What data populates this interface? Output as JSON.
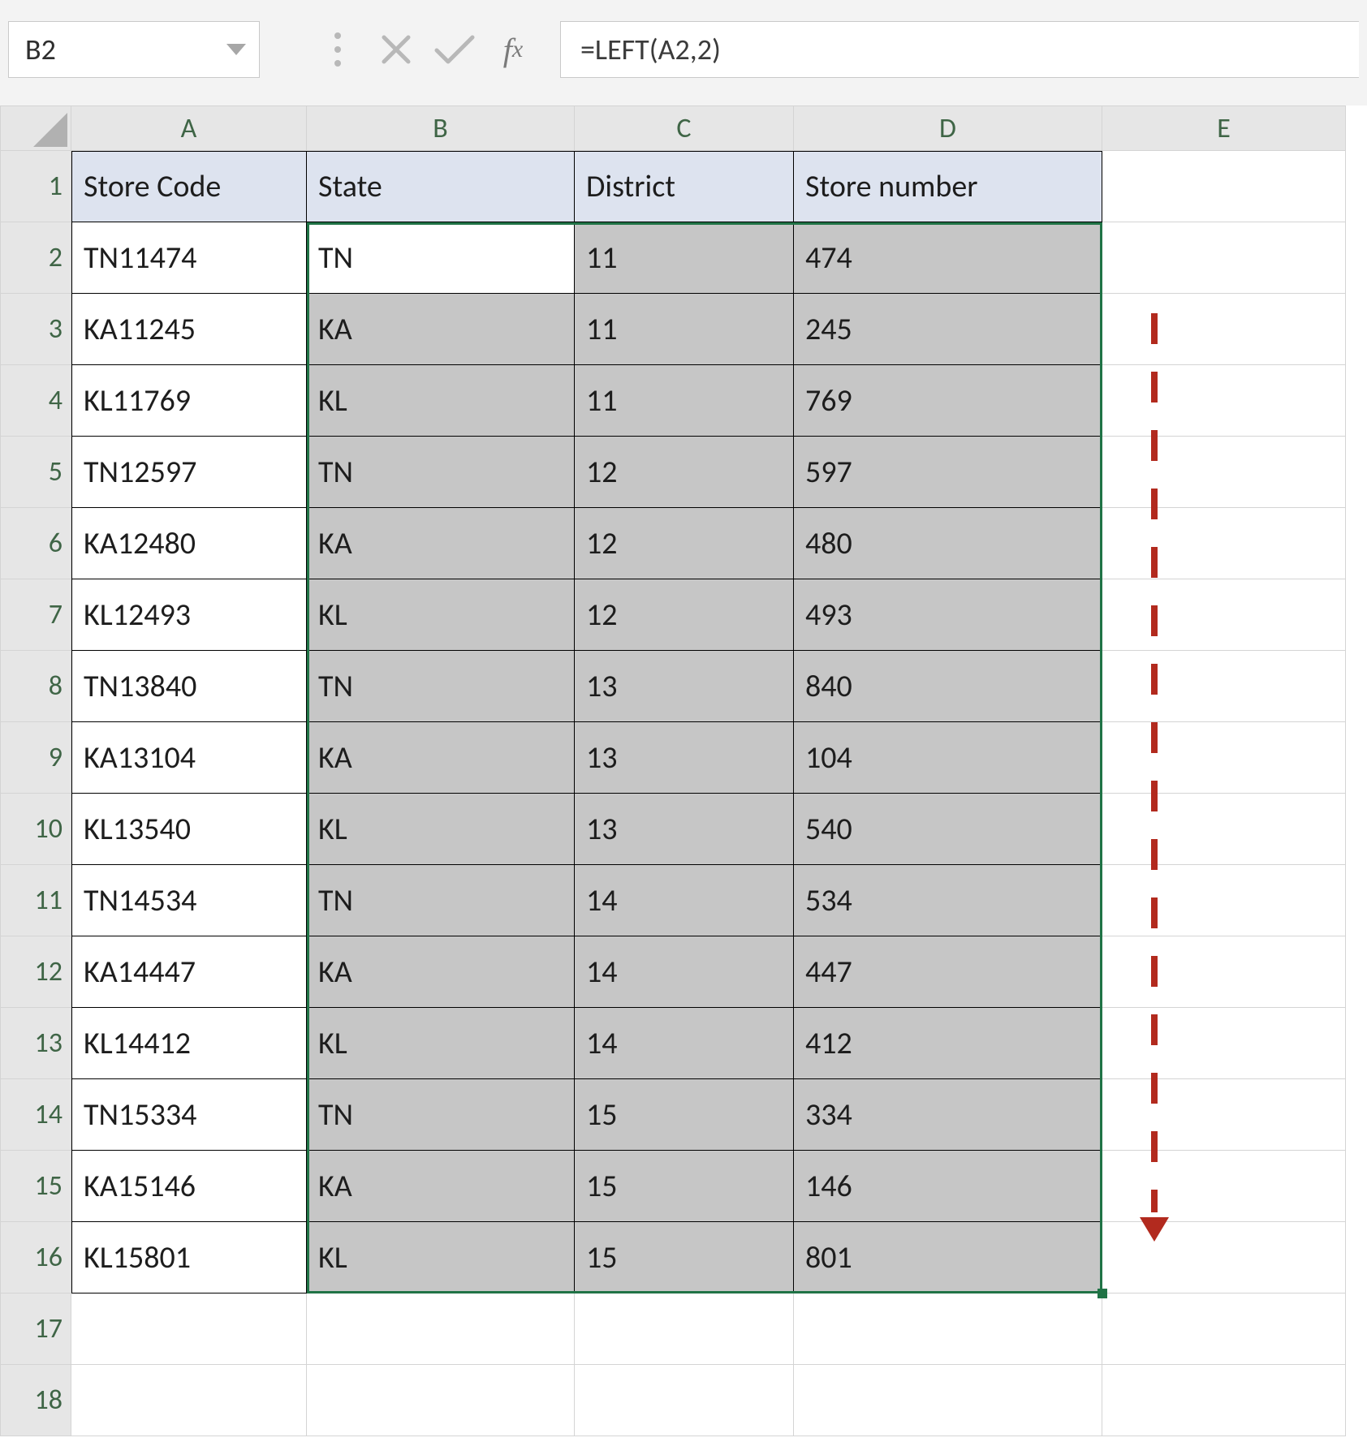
{
  "name_box": "B2",
  "formula_text": "=LEFT(A2,2)",
  "columns": [
    "A",
    "B",
    "C",
    "D",
    "E"
  ],
  "row_labels": [
    "1",
    "2",
    "3",
    "4",
    "5",
    "6",
    "7",
    "8",
    "9",
    "10",
    "11",
    "12",
    "13",
    "14",
    "15",
    "16",
    "17",
    "18"
  ],
  "headers": {
    "A": "Store Code",
    "B": "State",
    "C": "District",
    "D": "Store number"
  },
  "data_rows": [
    {
      "A": "TN11474",
      "B": "TN",
      "C": "11",
      "D": "474"
    },
    {
      "A": "KA11245",
      "B": "KA",
      "C": "11",
      "D": "245"
    },
    {
      "A": "KL11769",
      "B": "KL",
      "C": "11",
      "D": "769"
    },
    {
      "A": "TN12597",
      "B": "TN",
      "C": "12",
      "D": "597"
    },
    {
      "A": "KA12480",
      "B": "KA",
      "C": "12",
      "D": "480"
    },
    {
      "A": "KL12493",
      "B": "KL",
      "C": "12",
      "D": "493"
    },
    {
      "A": "TN13840",
      "B": "TN",
      "C": "13",
      "D": "840"
    },
    {
      "A": "KA13104",
      "B": "KA",
      "C": "13",
      "D": "104"
    },
    {
      "A": "KL13540",
      "B": "KL",
      "C": "13",
      "D": "540"
    },
    {
      "A": "TN14534",
      "B": "TN",
      "C": "14",
      "D": "534"
    },
    {
      "A": "KA14447",
      "B": "KA",
      "C": "14",
      "D": "447"
    },
    {
      "A": "KL14412",
      "B": "KL",
      "C": "14",
      "D": "412"
    },
    {
      "A": "TN15334",
      "B": "TN",
      "C": "15",
      "D": "334"
    },
    {
      "A": "KA15146",
      "B": "KA",
      "C": "15",
      "D": "146"
    },
    {
      "A": "KL15801",
      "B": "KL",
      "C": "15",
      "D": "801"
    }
  ]
}
